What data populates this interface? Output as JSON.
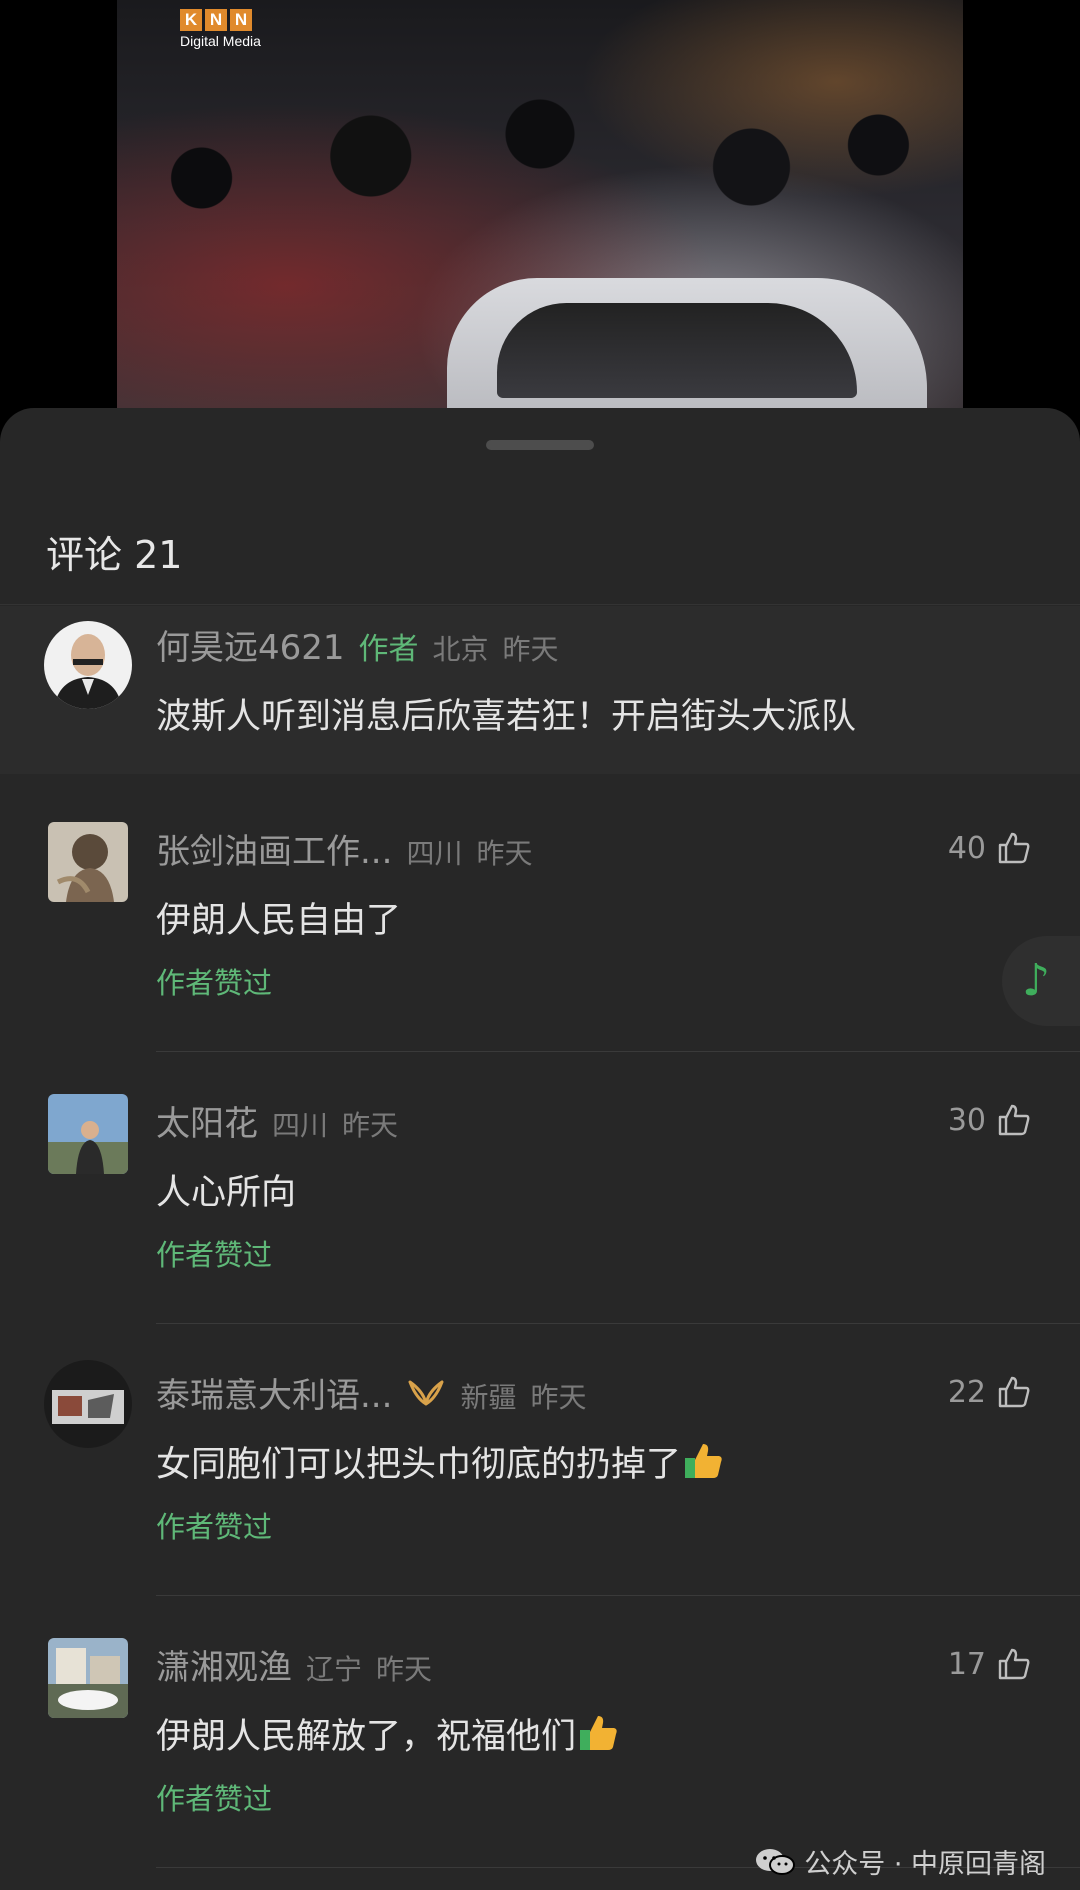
{
  "video": {
    "logo_letters": [
      "K",
      "N",
      "N"
    ],
    "logo_sub": "Digital Media"
  },
  "sheet": {
    "title": "评论 21"
  },
  "comments": [
    {
      "name": "何昊远4621",
      "author_tag": "作者",
      "location": "北京",
      "time": "昨天",
      "text": "波斯人听到消息后欣喜若狂！开启街头大派队",
      "is_author": true
    },
    {
      "name": "张剑油画工作...",
      "location": "四川",
      "time": "昨天",
      "likes": "40",
      "text": "伊朗人民自由了",
      "liked_label": "作者赞过"
    },
    {
      "name": "太阳花",
      "location": "四川",
      "time": "昨天",
      "likes": "30",
      "text": "人心所向",
      "liked_label": "作者赞过"
    },
    {
      "name": "泰瑞意大利语...",
      "badge_icon": "ribbon-badge-icon",
      "location": "新疆",
      "time": "昨天",
      "likes": "22",
      "text": "女同胞们可以把头巾彻底的扔掉了",
      "liked_label": "作者赞过"
    },
    {
      "name": "潇湘观渔",
      "location": "辽宁",
      "time": "昨天",
      "likes": "17",
      "text": "伊朗人民解放了，祝福他们",
      "liked_label": "作者赞过"
    }
  ],
  "watermark": {
    "text": "公众号 · 中原回青阁"
  },
  "colors": {
    "sheet_bg": "#272727",
    "accent_green": "#5fb878",
    "text_primary": "#e4e4e4",
    "text_secondary": "#9a9a9a"
  }
}
